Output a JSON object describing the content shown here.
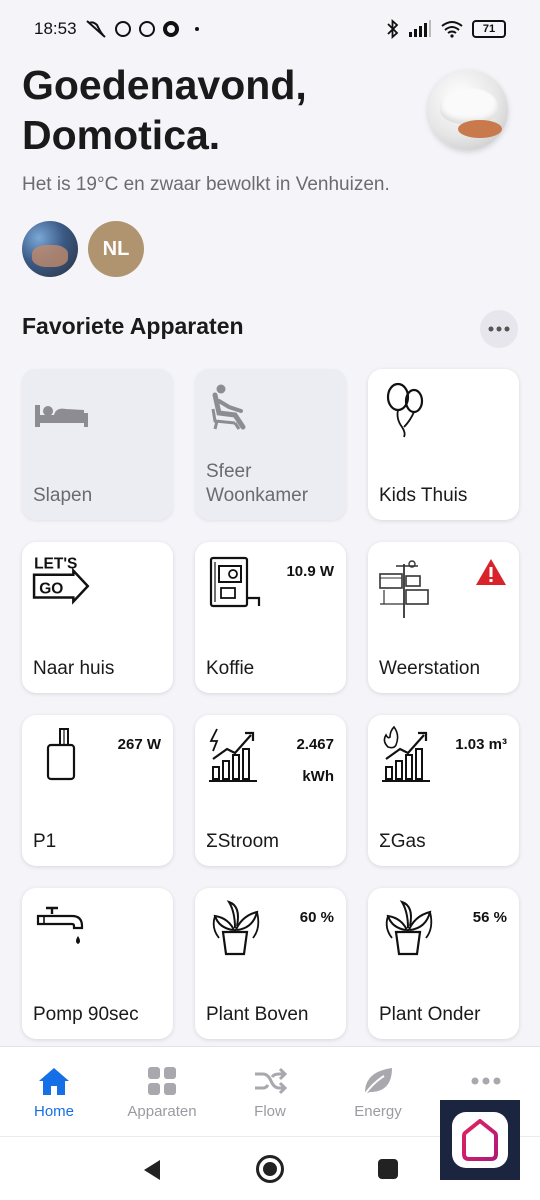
{
  "status_bar": {
    "time": "18:53",
    "battery": "71"
  },
  "header": {
    "greeting": "Goedenavond, Domotica.",
    "weather": "Het is 19°C en zwaar bewolkt in Venhuizen.",
    "users": [
      {
        "initials": ""
      },
      {
        "initials": "NL"
      }
    ]
  },
  "favorites": {
    "title": "Favoriete Apparaten",
    "tiles": [
      {
        "label": "Slapen",
        "value": "",
        "state": "off"
      },
      {
        "label": "Sfeer Woonkamer",
        "value": "",
        "state": "off"
      },
      {
        "label": "Kids Thuis",
        "value": "",
        "state": "on"
      },
      {
        "label": "Naar huis",
        "value": "",
        "state": "on"
      },
      {
        "label": "Koffie",
        "value": "10.9 W",
        "state": "on"
      },
      {
        "label": "Weerstation",
        "value": "",
        "state": "on"
      },
      {
        "label": "P1",
        "value": "267 W",
        "state": "on"
      },
      {
        "label": "ΣStroom",
        "value": "2.467 kWh",
        "value_line1": "2.467",
        "value_line2": "kWh",
        "state": "on"
      },
      {
        "label": "ΣGas",
        "value": "1.03 m³",
        "state": "on"
      },
      {
        "label": "Pomp 90sec",
        "value": "",
        "state": "on"
      },
      {
        "label": "Plant Boven",
        "value": "60 %",
        "state": "on"
      },
      {
        "label": "Plant Onder",
        "value": "56 %",
        "state": "on"
      }
    ]
  },
  "icons": {
    "lets_go_line1": "LET'S",
    "lets_go_line2": "GO"
  },
  "nav": {
    "items": [
      {
        "label": "Home",
        "active": true
      },
      {
        "label": "Apparaten",
        "active": false
      },
      {
        "label": "Flow",
        "active": false
      },
      {
        "label": "Energy",
        "active": false
      },
      {
        "label": "",
        "active": false
      }
    ]
  },
  "colors": {
    "accent": "#1570e8",
    "warning": "#d8232a",
    "background": "#f4f4f9"
  }
}
